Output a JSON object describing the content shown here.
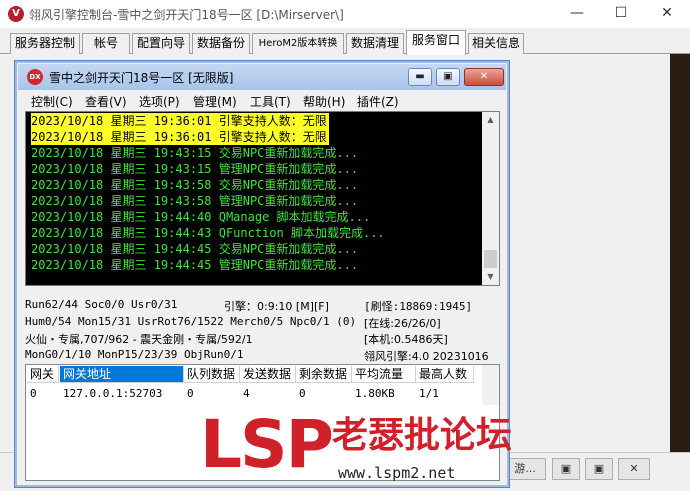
{
  "window": {
    "title": "翎风引擎控制台-雪中之剑开天门18号一区 [D:\\Mirserver\\]",
    "minimize": "—",
    "maximize": "☐",
    "close": "✕"
  },
  "tabs": [
    "服务器控制",
    "帐号",
    "配置向导",
    "数据备份",
    "HeroM2版本转换",
    "数据清理",
    "服务窗口",
    "相关信息"
  ],
  "active_tab": "服务窗口",
  "child": {
    "icon_text": "DX",
    "title": "雪中之剑开天门18号一区 [无限版]",
    "buttons": {
      "minimize": "▬",
      "restore": "▣",
      "close": "✕"
    }
  },
  "menu": [
    "控制(C)",
    "查看(V)",
    "选项(P)",
    "管理(M)",
    "工具(T)",
    "帮助(H)",
    "插件(Z)"
  ],
  "log": [
    {
      "text": "2023/10/18 星期三 19:36:01 引擎支持人数：无限",
      "highlight": true
    },
    {
      "text": "2023/10/18 星期三 19:36:01 引擎支持人数：无限",
      "highlight": true
    },
    {
      "text": "2023/10/18 星期三 19:43:15 交易NPC重新加载完成...",
      "highlight": false
    },
    {
      "text": "2023/10/18 星期三 19:43:15 管理NPC重新加载完成...",
      "highlight": false
    },
    {
      "text": "2023/10/18 星期三 19:43:58 交易NPC重新加载完成...",
      "highlight": false
    },
    {
      "text": "2023/10/18 星期三 19:43:58 管理NPC重新加载完成...",
      "highlight": false
    },
    {
      "text": "2023/10/18 星期三 19:44:40 QManage 脚本加载完成...",
      "highlight": false
    },
    {
      "text": "2023/10/18 星期三 19:44:43 QFunction 脚本加载完成...",
      "highlight": false
    },
    {
      "text": "2023/10/18 星期三 19:44:45 交易NPC重新加载完成...",
      "highlight": false
    },
    {
      "text": "2023/10/18 星期三 19:44:45 管理NPC重新加载完成...",
      "highlight": false
    }
  ],
  "status": {
    "run": "Run62/44 Soc0/0 Usr0/31",
    "engine_time": "引擎：0:9:10 [M][F]",
    "refresh": "[刷怪:18869:1945]",
    "hum": "Hum0/54 Mon15/31 UsrRot76/1522 Merch0/5 Npc0/1 (0)",
    "online": "[在线:26/26/0]",
    "guard": "火仙・专属,707/962 - 震天金刚・专属/592/1",
    "runtime": "[本机:0.5486天]",
    "mongo": "MonG0/1/10 MonP15/23/39 ObjRun0/1",
    "version": "翎风引擎:4.0 20231016"
  },
  "grid": {
    "headers": [
      "网关",
      "网关地址",
      "队列数据",
      "发送数据",
      "剩余数据",
      "平均流量",
      "最高人数"
    ],
    "rows": [
      [
        "0",
        "127.0.0.1:52703",
        "0",
        "4",
        "0",
        "1.80KB",
        "1/1"
      ]
    ]
  },
  "taskbar": {
    "app_label": "游...",
    "restore": "▣",
    "max": "▣",
    "close": "✕"
  },
  "watermark": {
    "brand": "LSP",
    "cn": "老瑟批论坛",
    "url": "www.lspm2.net"
  }
}
